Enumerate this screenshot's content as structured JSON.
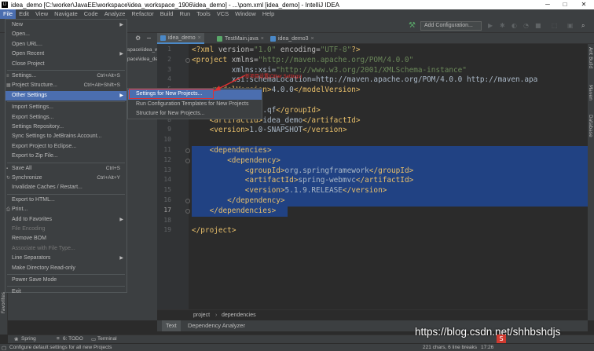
{
  "window": {
    "title": "idea_demo [C:\\worker\\JavaEE\\workspace\\idea_workspace_1906\\idea_demo] - ...\\pom.xml [idea_demo] - IntelliJ IDEA",
    "minimize": "─",
    "maximize": "□",
    "close": "✕"
  },
  "menubar": [
    "File",
    "Edit",
    "View",
    "Navigate",
    "Code",
    "Analyze",
    "Refactor",
    "Build",
    "Run",
    "Tools",
    "VCS",
    "Window",
    "Help"
  ],
  "toolbar": {
    "add_configuration": "Add Configuration..."
  },
  "project_panel": {
    "path_line1": "space\\idea_w",
    "path_line2": "pace\\idea_demo"
  },
  "tabs": [
    {
      "label": "idea_demo",
      "active": true
    },
    {
      "label": "TestMain.java",
      "active": false
    },
    {
      "label": "idea_demo3",
      "active": false
    }
  ],
  "file_menu": [
    {
      "label": "New",
      "arrow": true
    },
    {
      "label": "Open..."
    },
    {
      "label": "Open URL..."
    },
    {
      "label": "Open Recent",
      "arrow": true
    },
    {
      "label": "Close Project"
    },
    {
      "sep": true
    },
    {
      "label": "Settings...",
      "shortcut": "Ctrl+Alt+S",
      "icon": "≡"
    },
    {
      "label": "Project Structure...",
      "shortcut": "Ctrl+Alt+Shift+S",
      "icon": "▦"
    },
    {
      "label": "Other Settings",
      "arrow": true,
      "highlight": true
    },
    {
      "sep": true
    },
    {
      "label": "Import Settings..."
    },
    {
      "label": "Export Settings..."
    },
    {
      "label": "Settings Repository..."
    },
    {
      "label": "Sync Settings to JetBrains Account..."
    },
    {
      "label": "Export Project to Eclipse..."
    },
    {
      "label": "Export to Zip File..."
    },
    {
      "sep": true
    },
    {
      "label": "Save All",
      "shortcut": "Ctrl+S",
      "icon": "▪"
    },
    {
      "label": "Synchronize",
      "shortcut": "Ctrl+Alt+Y",
      "icon": "↻"
    },
    {
      "label": "Invalidate Caches / Restart..."
    },
    {
      "sep": true
    },
    {
      "label": "Export to HTML..."
    },
    {
      "label": "Print...",
      "icon": "⎙"
    },
    {
      "label": "Add to Favorites",
      "arrow": true
    },
    {
      "label": "File Encoding",
      "disabled": true
    },
    {
      "label": "Remove BOM"
    },
    {
      "label": "Associate with File Type...",
      "disabled": true
    },
    {
      "label": "Line Separators",
      "arrow": true
    },
    {
      "label": "Make Directory Read-only"
    },
    {
      "sep": true
    },
    {
      "label": "Power Save Mode"
    },
    {
      "sep": true
    },
    {
      "label": "Exit"
    }
  ],
  "submenu": [
    {
      "label": "Settings for New Projects...",
      "highlight": true
    },
    {
      "label": "Run Configuration Templates for New Projects"
    },
    {
      "label": "Structure for New Projects..."
    }
  ],
  "annotation": {
    "text": "新项目设置(Other Settings)"
  },
  "editor": {
    "lines": [
      {
        "n": "1",
        "c": "<?xml version=\"1.0\" encoding=\"UTF-8\"?>"
      },
      {
        "n": "2",
        "c": "<project xmlns=\"http://maven.apache.org/POM/4.0.0\""
      },
      {
        "n": "3",
        "c": "         xmlns:xsi=\"http://www.w3.org/2001/XMLSchema-instance\""
      },
      {
        "n": "4",
        "c": "         xsi:schemaLocation=\"http://maven.apache.org/POM/4.0.0 http://maven.apa"
      },
      {
        "n": "5",
        "c": "    <modelVersion>4.0.0</modelVersion>"
      },
      {
        "n": "6",
        "c": ""
      },
      {
        "n": "7",
        "c": "    <groupId>com.qf</groupId>"
      },
      {
        "n": "8",
        "c": "    <artifactId>idea_demo</artifactId>"
      },
      {
        "n": "9",
        "c": "    <version>1.0-SNAPSHOT</version>"
      },
      {
        "n": "10",
        "c": ""
      },
      {
        "n": "11",
        "c": "    <dependencies>"
      },
      {
        "n": "12",
        "c": "        <dependency>"
      },
      {
        "n": "13",
        "c": "            <groupId>org.springframework</groupId>"
      },
      {
        "n": "14",
        "c": "            <artifactId>spring-webmvc</artifactId>"
      },
      {
        "n": "15",
        "c": "            <version>5.1.9.RELEASE</version>"
      },
      {
        "n": "16",
        "c": "        </dependency>"
      },
      {
        "n": "17",
        "c": "    </dependencies>"
      },
      {
        "n": "18",
        "c": ""
      },
      {
        "n": "19",
        "c": "</project>"
      }
    ]
  },
  "right_tools": [
    "Ant Build",
    "Maven",
    "Database"
  ],
  "breadcrumb": [
    "project",
    "dependencies"
  ],
  "subtabs": [
    "Text",
    "Dependency Analyzer"
  ],
  "tooltabs": [
    "Favorites",
    "Spring",
    "6: TODO",
    "Terminal"
  ],
  "status": {
    "message": "Configure default settings for all new Projects",
    "chars": "221 chars, 6 line breaks",
    "position": "17:26"
  },
  "watermark": "https://blog.csdn.net/shhbshdjs"
}
